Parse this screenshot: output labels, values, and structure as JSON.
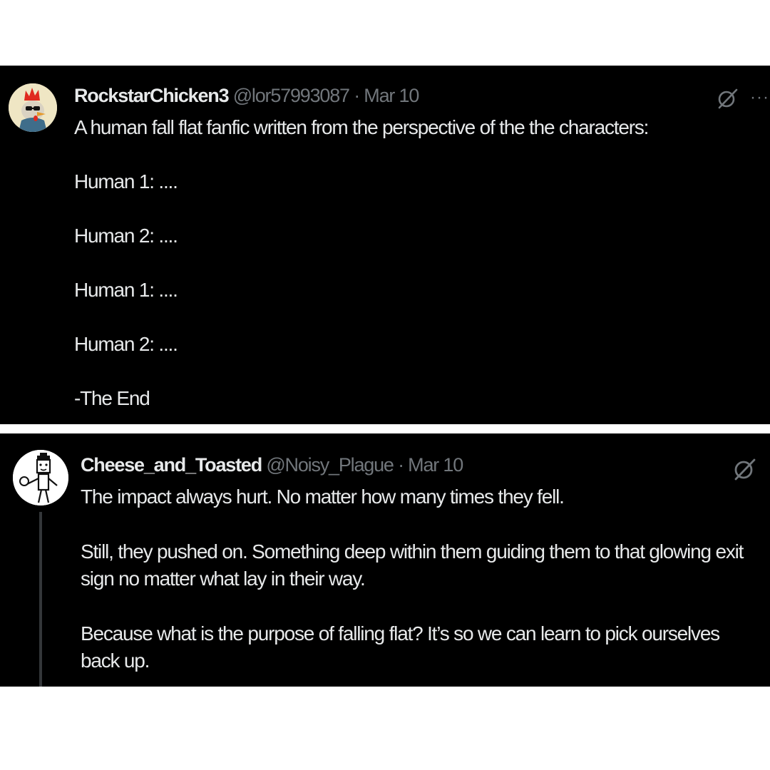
{
  "posts": [
    {
      "display_name": "RockstarChicken3",
      "handle": "@lor57993087",
      "separator": "·",
      "date": "Mar 10",
      "paragraphs": [
        "A human fall flat fanfic written from the perspective of the the characters:",
        "Human 1: ....",
        "Human 2: ....",
        "Human 1: ....",
        "Human 2: ....",
        "-The End"
      ],
      "avatar_icon": "rooster-avatar",
      "action_icons": [
        "grok-icon",
        "more-icon"
      ],
      "more_label": "···"
    },
    {
      "display_name": "Cheese_and_Toasted",
      "handle": "@Noisy_Plague",
      "separator": "·",
      "date": "Mar 10",
      "paragraphs": [
        "The impact always hurt. No matter how many times they fell.",
        "Still, they pushed on. Something deep within them guiding them to that glowing exit sign no matter what lay in their way.",
        "Because what is the purpose of falling flat? It’s so we can learn to pick ourselves back up."
      ],
      "avatar_icon": "stick-figure-avatar",
      "action_icons": [
        "grok-icon"
      ]
    }
  ],
  "colors": {
    "panel_background": "#000000",
    "page_background": "#ffffff",
    "primary_text": "#e7e9ea",
    "secondary_text": "#71767b",
    "thread_line": "#333639"
  }
}
